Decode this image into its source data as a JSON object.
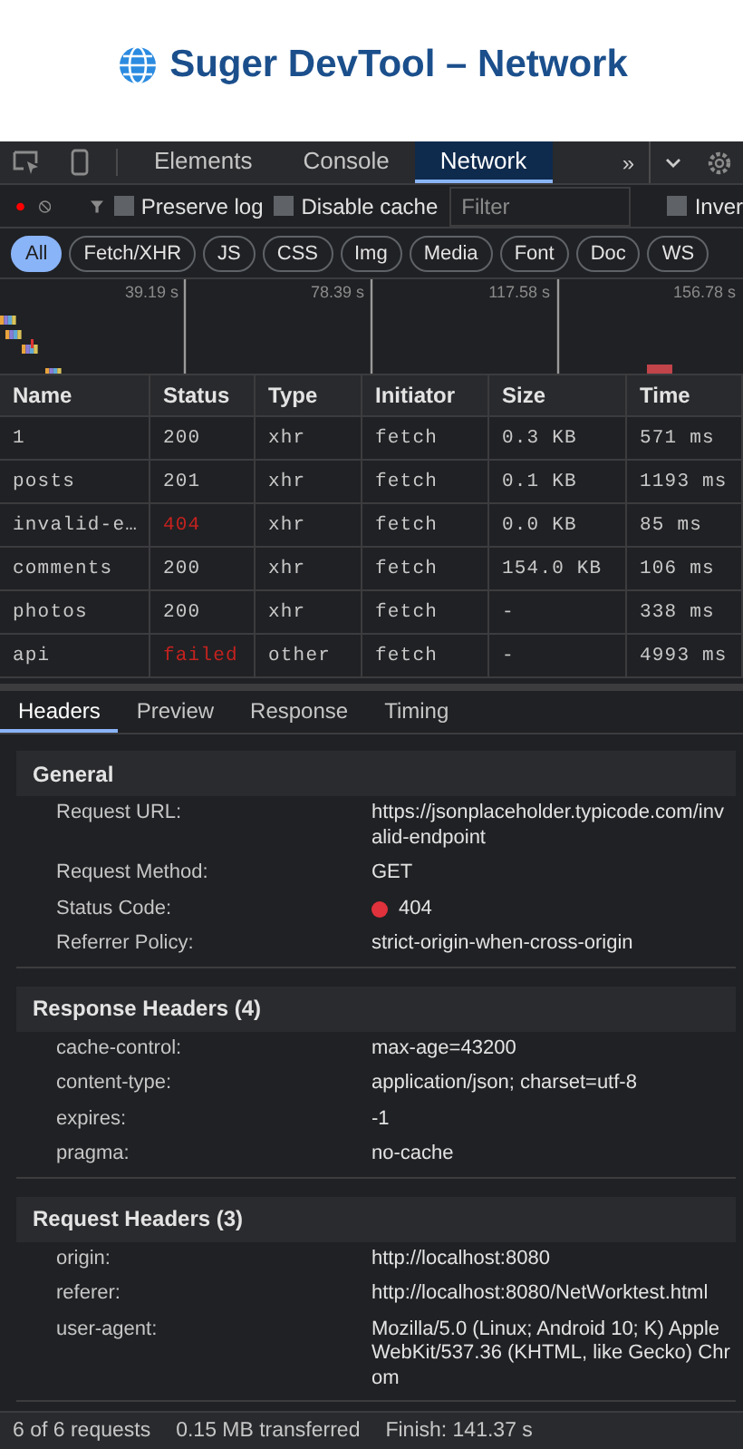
{
  "page_title": "Suger DevTool – Network",
  "panel_tabs": [
    {
      "label": "Elements",
      "selected": false
    },
    {
      "label": "Console",
      "selected": false
    },
    {
      "label": "Network",
      "selected": true
    }
  ],
  "more_tabs": "»",
  "toolbar": {
    "recording": true,
    "preserve_log": {
      "label": "Preserve log",
      "checked": false
    },
    "disable_cache": {
      "label": "Disable cache",
      "checked": false
    },
    "filter": {
      "placeholder": "Filter"
    },
    "invert": {
      "label": "Inver",
      "checked": false
    }
  },
  "type_filters": [
    {
      "label": "All",
      "selected": true
    },
    {
      "label": "Fetch/XHR",
      "selected": false
    },
    {
      "label": "JS",
      "selected": false
    },
    {
      "label": "CSS",
      "selected": false
    },
    {
      "label": "Img",
      "selected": false
    },
    {
      "label": "Media",
      "selected": false
    },
    {
      "label": "Font",
      "selected": false
    },
    {
      "label": "Doc",
      "selected": false
    },
    {
      "label": "WS",
      "selected": false
    }
  ],
  "overview": {
    "ticks": [
      "39.19 s",
      "78.39 s",
      "117.58 s",
      "156.78 s"
    ]
  },
  "table": {
    "columns": [
      "Name",
      "Status",
      "Type",
      "Initiator",
      "Size",
      "Time"
    ],
    "rows": [
      {
        "name": "1",
        "status": "200",
        "type": "xhr",
        "initiator": "fetch",
        "size": "0.3 KB",
        "time": "571 ms",
        "error": false
      },
      {
        "name": "posts",
        "status": "201",
        "type": "xhr",
        "initiator": "fetch",
        "size": "0.1 KB",
        "time": "1193 ms",
        "error": false
      },
      {
        "name": "invalid-e…",
        "status": "404",
        "type": "xhr",
        "initiator": "fetch",
        "size": "0.0 KB",
        "time": "85 ms",
        "error": true
      },
      {
        "name": "comments",
        "status": "200",
        "type": "xhr",
        "initiator": "fetch",
        "size": "154.0 KB",
        "time": "106 ms",
        "error": false
      },
      {
        "name": "photos",
        "status": "200",
        "type": "xhr",
        "initiator": "fetch",
        "size": "-",
        "time": "338 ms",
        "error": false
      },
      {
        "name": "api",
        "status": "failed",
        "type": "other",
        "initiator": "fetch",
        "size": "-",
        "time": "4993 ms",
        "error": true
      }
    ]
  },
  "detail_tabs": [
    {
      "label": "Headers",
      "selected": true
    },
    {
      "label": "Preview",
      "selected": false
    },
    {
      "label": "Response",
      "selected": false
    },
    {
      "label": "Timing",
      "selected": false
    }
  ],
  "sections": [
    {
      "title": "General",
      "rows": [
        {
          "kind": "text",
          "label": "Request URL:",
          "value": "https://jsonplaceholder.typicode.com/invalid-endpoint"
        },
        {
          "kind": "text",
          "label": "Request Method:",
          "value": "GET"
        },
        {
          "kind": "status",
          "label": "Status Code:",
          "value": "404",
          "ok": false
        },
        {
          "kind": "text",
          "label": "Referrer Policy:",
          "value": "strict-origin-when-cross-origin"
        }
      ]
    },
    {
      "title": "Response Headers (4)",
      "rows": [
        {
          "kind": "text",
          "label": "cache-control:",
          "value": "max-age=43200"
        },
        {
          "kind": "text",
          "label": "content-type:",
          "value": "application/json; charset=utf-8"
        },
        {
          "kind": "text",
          "label": "expires:",
          "value": "-1"
        },
        {
          "kind": "text",
          "label": "pragma:",
          "value": "no-cache"
        }
      ]
    },
    {
      "title": "Request Headers (3)",
      "rows": [
        {
          "kind": "text",
          "label": "origin:",
          "value": "http://localhost:8080"
        },
        {
          "kind": "text",
          "label": "referer:",
          "value": "http://localhost:8080/NetWorktest.html"
        },
        {
          "kind": "text",
          "label": "user-agent:",
          "value": "Mozilla/5.0 (Linux; Android 10; K) AppleWebKit/537.36 (KHTML, like Gecko) Chrom"
        }
      ]
    }
  ],
  "status_bar": [
    "6 of 6 requests",
    "0.15 MB transferred",
    "Finish: 141.37 s"
  ]
}
